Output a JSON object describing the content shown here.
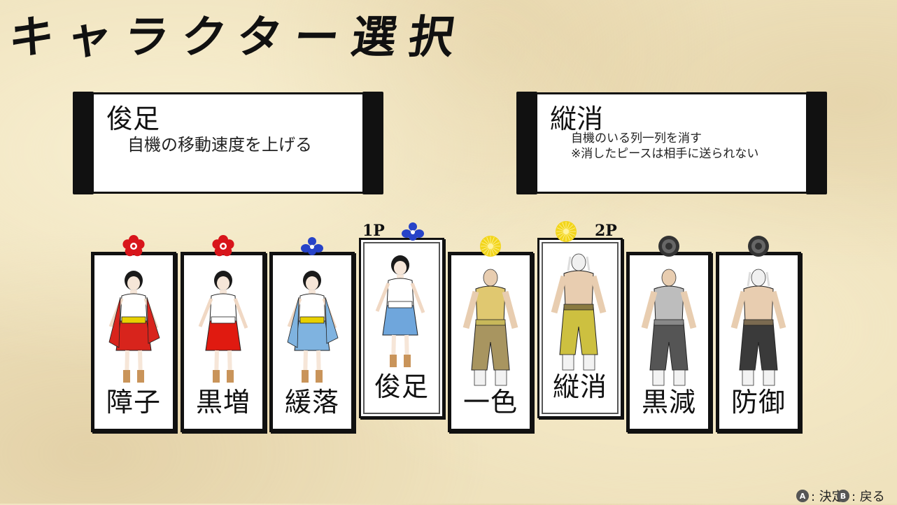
{
  "title": "キャラクター選択",
  "player1_panel": {
    "name": "俊足",
    "description": "自機の移動速度を上げる"
  },
  "player2_panel": {
    "name": "縦消",
    "description_line1": "自機のいる列一列を消す",
    "description_line2": "※消したピースは相手に送られない"
  },
  "player_labels": {
    "p1": "1P",
    "p2": "2P"
  },
  "characters": [
    {
      "name": "障子",
      "crest_color": "#d8151b",
      "crest_icon": "plum-crest-icon",
      "outfit": "#d8241c",
      "sash": "#e8d000"
    },
    {
      "name": "黒増",
      "crest_color": "#d8151b",
      "crest_icon": "plum-crest-icon",
      "outfit": "#e01a10",
      "sash": "#ffffff"
    },
    {
      "name": "緩落",
      "crest_color": "#2743c8",
      "crest_icon": "wisteria-crest-icon",
      "outfit": "#7fb3e0",
      "sash": "#e8d000"
    },
    {
      "name": "俊足",
      "crest_color": "#2743c8",
      "crest_icon": "wisteria-crest-icon",
      "outfit": "#6fa6dc",
      "sash": "#ffffff"
    },
    {
      "name": "一色",
      "crest_color": "#f2d51a",
      "crest_icon": "chrysanthemum-crest-icon",
      "outfit": "#a89560",
      "sash": "#c8b85a"
    },
    {
      "name": "縦消",
      "crest_color": "#f2d51a",
      "crest_icon": "chrysanthemum-crest-icon",
      "outfit": "#cdc040",
      "sash": "#8a7a40"
    },
    {
      "name": "黒減",
      "crest_color": "#333333",
      "crest_icon": "gear-crest-icon",
      "outfit": "#555555",
      "sash": "#888888"
    },
    {
      "name": "防御",
      "crest_color": "#333333",
      "crest_icon": "gear-crest-icon",
      "outfit": "#3a3a3a",
      "sash": "#7a6a50"
    }
  ],
  "selection": {
    "p1_index": 3,
    "p2_index": 5
  },
  "hints": {
    "a_button": "A",
    "confirm": ": 決定",
    "b_button": "B",
    "back": ": 戻る"
  }
}
